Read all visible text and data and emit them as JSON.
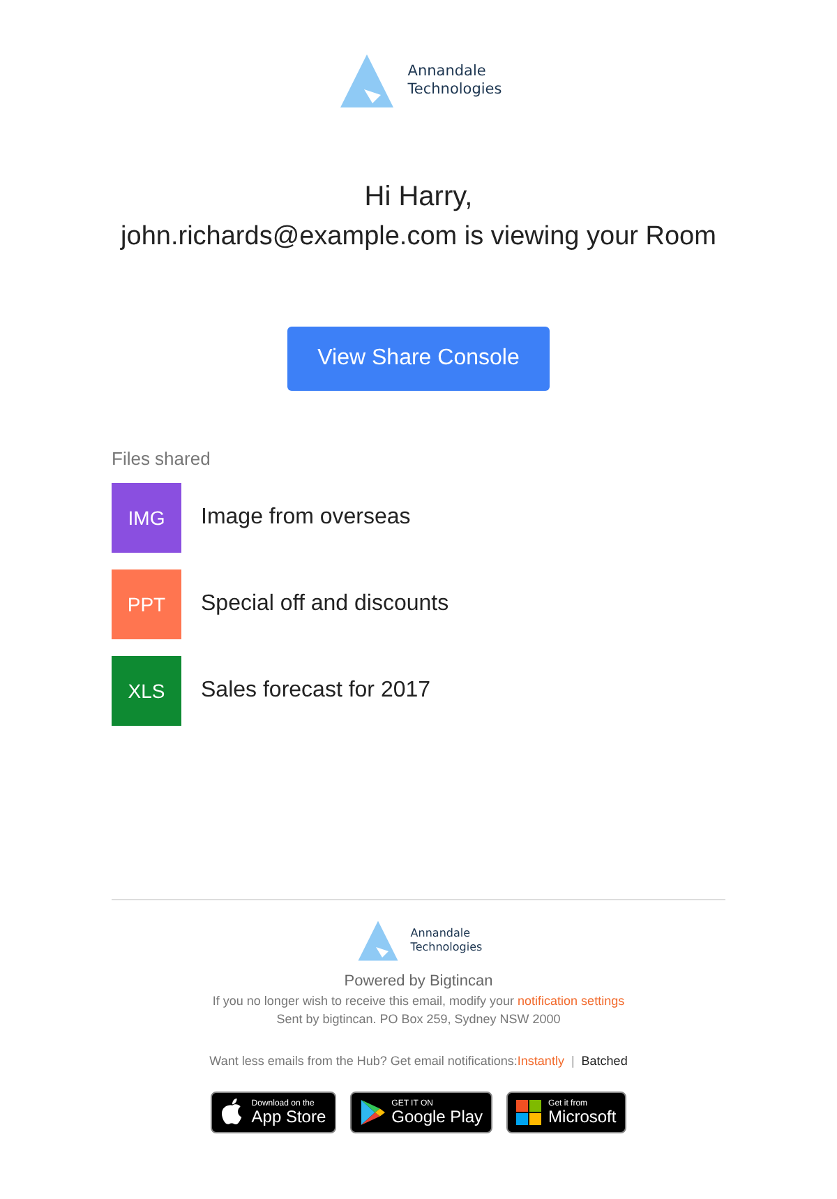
{
  "logo": {
    "name_line1": "Annandale",
    "name_line2": "Technologies"
  },
  "greeting": "Hi Harry,",
  "message": "john.richards@example.com is viewing your Room",
  "cta_button": "View Share Console",
  "files": {
    "heading": "Files shared",
    "items": [
      {
        "type": "IMG",
        "name": "Image from overseas",
        "color": "#8a4fe0"
      },
      {
        "type": "PPT",
        "name": "Special off and discounts",
        "color": "#ff7550"
      },
      {
        "type": "XLS",
        "name": "Sales forecast for 2017",
        "color": "#0e8a32"
      }
    ]
  },
  "footer": {
    "logo": {
      "name_line1": "Annandale",
      "name_line2": "Technologies"
    },
    "powered_by": "Powered by Bigtincan",
    "unsubscribe_text": "If you no longer wish to receive this email, modify your",
    "unsubscribe_link": "notification settings",
    "address": "Sent by bigtincan. PO Box 259, Sydney NSW 2000",
    "frequency_prompt": "Want less emails from the Hub? Get email notifications:",
    "frequency_options": [
      {
        "label": "Instantly",
        "selected": false
      },
      {
        "label": "Batched",
        "selected": true
      }
    ],
    "separator": "|",
    "store_badges": [
      {
        "kind": "apple",
        "small": "Download on the",
        "large": "App Store"
      },
      {
        "kind": "google",
        "small": "GET IT ON",
        "large": "Google Play"
      },
      {
        "kind": "microsoft",
        "small": "Get it from",
        "large": "Microsoft"
      }
    ]
  }
}
